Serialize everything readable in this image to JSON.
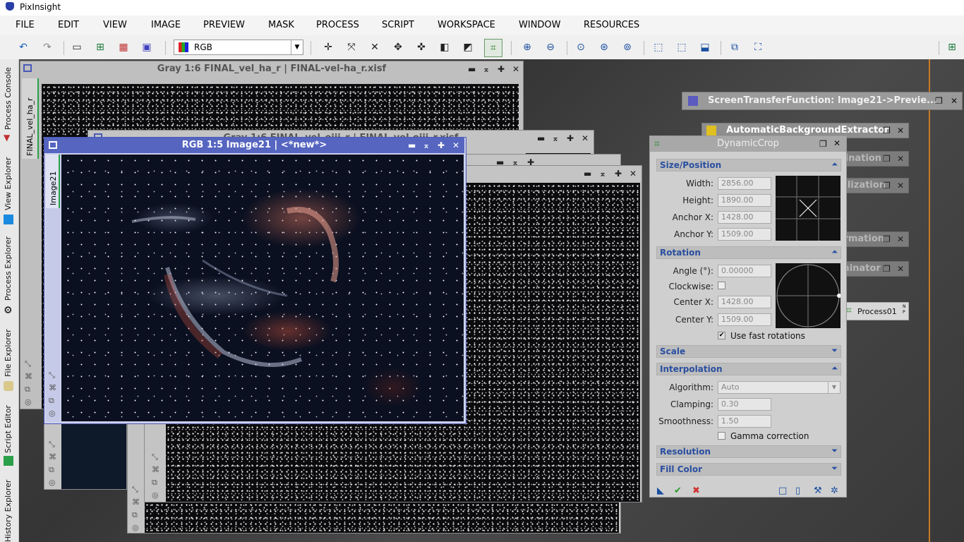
{
  "app": {
    "title": "PixInsight",
    "accent": "#2a3ea8"
  },
  "menu": [
    "FILE",
    "EDIT",
    "VIEW",
    "IMAGE",
    "PREVIEW",
    "MASK",
    "PROCESS",
    "SCRIPT",
    "WORKSPACE",
    "WINDOW",
    "RESOURCES"
  ],
  "toolbar": {
    "channel_select": "RGB"
  },
  "left_tabs": [
    "Process Console",
    "View Explorer",
    "Process Explorer",
    "File Explorer",
    "Script Editor",
    "History Explorer"
  ],
  "windows": {
    "win1": {
      "title": "Gray 1:6 FINAL_vel_ha_r | FINAL-vel-ha_r.xisf",
      "tab": "FINAL_vel_ha_r"
    },
    "win2": {
      "title": "Gray 1:6 FINAL_vel_oiii_r | FINAL-vel-oiii_r.xisf"
    },
    "win21": {
      "title": "RGB 1:5 Image21 | <*new*>",
      "tab": "Image21"
    }
  },
  "process_windows": {
    "stf": "ScreenTransferFunction: Image21->Previe...",
    "abe": "AutomaticBackgroundExtractor",
    "cc": "ChannelCombination",
    "bn": "BackgroundNeutralization",
    "ct": "CurvesTransformation",
    "sx": "StarXTerminator",
    "process01": "Process01",
    "np_label": "N P"
  },
  "dynamic_crop": {
    "title": "DynamicCrop",
    "size_position": {
      "header": "Size/Position",
      "width_label": "Width:",
      "width": "2856.00",
      "height_label": "Height:",
      "height": "1890.00",
      "anchor_x_label": "Anchor X:",
      "anchor_x": "1428.00",
      "anchor_y_label": "Anchor Y:",
      "anchor_y": "1509.00"
    },
    "rotation": {
      "header": "Rotation",
      "angle_label": "Angle (°):",
      "angle": "0.00000",
      "clockwise_label": "Clockwise:",
      "center_x_label": "Center X:",
      "center_x": "1428.00",
      "center_y_label": "Center Y:",
      "center_y": "1509.00",
      "fast_label": "Use fast rotations"
    },
    "scale": {
      "header": "Scale"
    },
    "interpolation": {
      "header": "Interpolation",
      "algorithm_label": "Algorithm:",
      "algorithm": "Auto",
      "clamping_label": "Clamping:",
      "clamping": "0.30",
      "smoothness_label": "Smoothness:",
      "smoothness": "1.50",
      "gamma_label": "Gamma correction"
    },
    "resolution": {
      "header": "Resolution"
    },
    "fill_color": {
      "header": "Fill Color"
    }
  }
}
